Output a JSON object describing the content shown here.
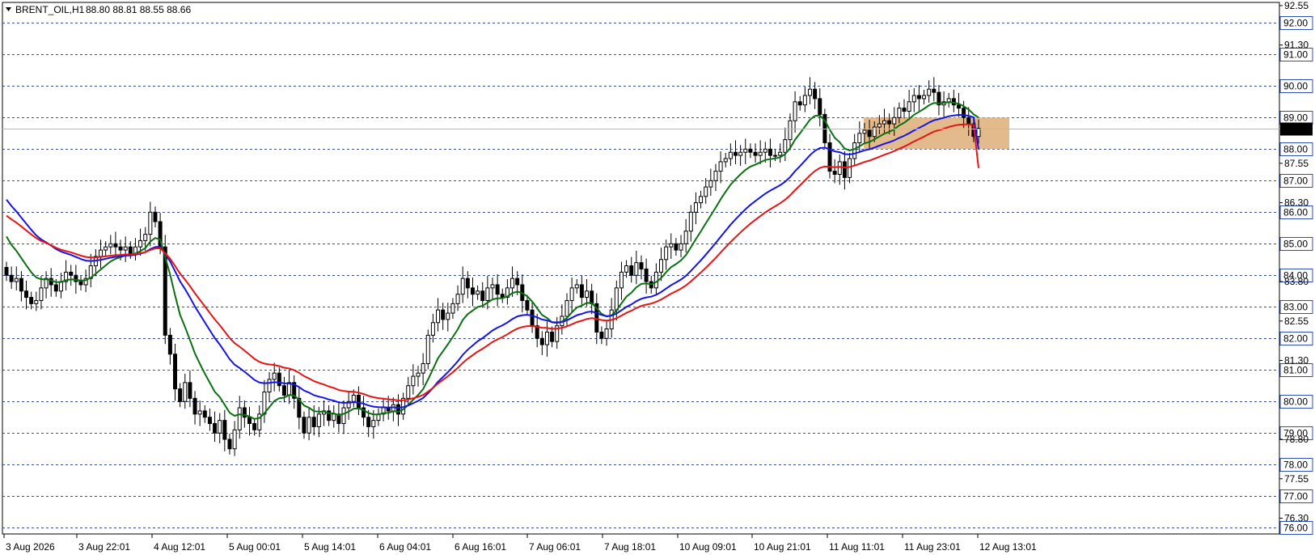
{
  "header": {
    "menu_icon": "triangle-down-icon",
    "symbol": "BRENT_OIL,H1",
    "ohlc": "88.80 88.81 88.55 88.66"
  },
  "chart_data": {
    "type": "candlestick",
    "symbol": "BRENT_OIL",
    "timeframe": "H1",
    "current_price": 88.66,
    "current_price_label": "88.66",
    "ylim": [
      75.8,
      92.65
    ],
    "grid": "horizontal dashed",
    "price_labels_dashed": [
      "92.00",
      "91.00",
      "90.00",
      "89.00",
      "88.00",
      "87.00",
      "86.00",
      "85.00",
      "84.00",
      "83.00",
      "82.00",
      "81.00",
      "80.00",
      "79.00",
      "78.00",
      "77.00",
      "76.00"
    ],
    "price_labels_plain": [
      "92.55",
      "91.30",
      "87.55",
      "86.30",
      "83.80",
      "82.55",
      "81.30",
      "78.80",
      "77.55",
      "76.30"
    ],
    "time_labels": [
      "3 Aug 2026",
      "3 Aug 22:01",
      "4 Aug 12:01",
      "5 Aug 00:01",
      "5 Aug 14:01",
      "6 Aug 04:01",
      "6 Aug 16:01",
      "7 Aug 06:01",
      "7 Aug 18:01",
      "10 Aug 09:01",
      "10 Aug 21:01",
      "11 Aug 11:01",
      "11 Aug 23:01",
      "12 Aug 13:01"
    ],
    "close_series": [
      84.0,
      83.8,
      83.9,
      83.5,
      83.3,
      83.1,
      83.2,
      83.6,
      83.9,
      83.7,
      83.5,
      83.8,
      84.1,
      84.0,
      83.8,
      83.7,
      83.9,
      84.3,
      84.6,
      84.8,
      84.9,
      85.0,
      84.9,
      84.8,
      84.9,
      84.7,
      84.9,
      85.1,
      85.3,
      86.0,
      85.7,
      84.9,
      82.1,
      81.5,
      80.4,
      80.0,
      80.6,
      80.1,
      79.6,
      79.7,
      79.5,
      79.3,
      79.0,
      79.4,
      78.8,
      78.5,
      79.1,
      79.8,
      79.5,
      79.3,
      79.1,
      79.6,
      80.3,
      80.7,
      80.9,
      80.5,
      80.2,
      80.6,
      80.1,
      79.5,
      79.0,
      79.5,
      79.2,
      79.6,
      79.7,
      79.4,
      79.6,
      79.3,
      79.8,
      80.0,
      80.2,
      79.8,
      79.5,
      79.2,
      79.4,
      79.6,
      79.8,
      79.7,
      79.9,
      79.6,
      80.1,
      80.5,
      80.8,
      80.9,
      81.2,
      82.1,
      82.5,
      82.9,
      82.6,
      82.8,
      83.1,
      83.4,
      83.9,
      83.6,
      83.4,
      83.5,
      83.2,
      83.6,
      83.7,
      83.4,
      83.3,
      83.6,
      83.9,
      83.7,
      83.2,
      82.9,
      82.4,
      82.0,
      81.8,
      82.2,
      81.9,
      82.4,
      82.7,
      83.2,
      83.6,
      83.7,
      83.3,
      83.5,
      83.1,
      82.2,
      82.0,
      82.3,
      82.9,
      83.6,
      84.1,
      84.3,
      84.0,
      84.4,
      84.2,
      83.8,
      83.6,
      84.1,
      84.5,
      84.9,
      85.0,
      84.8,
      85.0,
      85.4,
      86.0,
      86.3,
      86.5,
      86.8,
      87.0,
      87.3,
      87.6,
      87.7,
      87.9,
      87.8,
      87.9,
      88.0,
      87.9,
      87.8,
      87.9,
      88.0,
      87.8,
      87.8,
      87.9,
      88.3,
      88.9,
      89.5,
      89.4,
      89.7,
      89.9,
      89.6,
      89.1,
      88.2,
      87.3,
      87.2,
      87.6,
      87.1,
      87.7,
      88.2,
      88.5,
      88.6,
      88.4,
      88.7,
      88.8,
      88.9,
      88.8,
      89.0,
      89.3,
      89.2,
      89.5,
      89.7,
      89.6,
      89.7,
      89.9,
      89.8,
      89.4,
      89.5,
      89.6,
      89.4,
      89.3,
      89.0,
      88.8,
      88.4,
      88.66
    ],
    "moving_averages": [
      {
        "color": "#0a7010",
        "start": 85.5,
        "end": 89.0
      },
      {
        "color": "#1414e6",
        "start": 86.6,
        "end": 88.0
      },
      {
        "color": "#e61414",
        "start": 86.0,
        "end": 87.4
      }
    ],
    "highlight_zone": {
      "price_low": 88.0,
      "price_high": 89.0,
      "color": "#dfb482"
    }
  },
  "colors": {
    "grid": "#2f4fb8",
    "bull_fill": "#ffffff",
    "bear_fill": "#000000",
    "candle_stroke": "#000000",
    "current_price_bg": "#000000",
    "current_price_fg": "#ffffff",
    "bid_line": "#b8b8b8"
  }
}
